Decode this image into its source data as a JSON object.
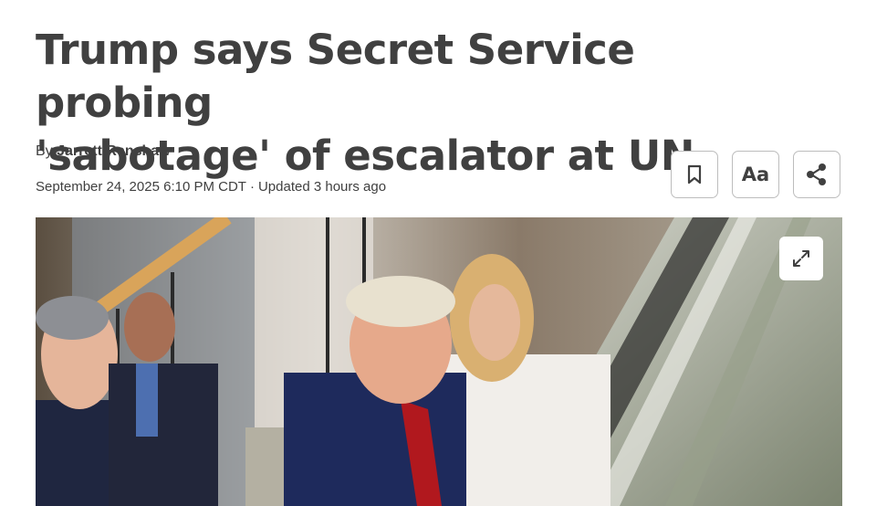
{
  "article": {
    "headline_line1": "Trump says Secret Service probing",
    "headline_line2": "'sabotage' of escalator at UN",
    "byline_prefix": "By",
    "author": "Jarrett Renshaw",
    "published": "September 24, 2025 6:10 PM CDT",
    "separator": "·",
    "updated": "Updated 3 hours ago"
  },
  "toolbar": {
    "bookmark_icon": "bookmark-icon",
    "text_size_label": "Aa",
    "share_icon": "share-icon"
  },
  "hero": {
    "expand_icon": "expand-icon"
  },
  "colors": {
    "text": "#404040",
    "border": "#bdbdbd",
    "background": "#ffffff"
  }
}
